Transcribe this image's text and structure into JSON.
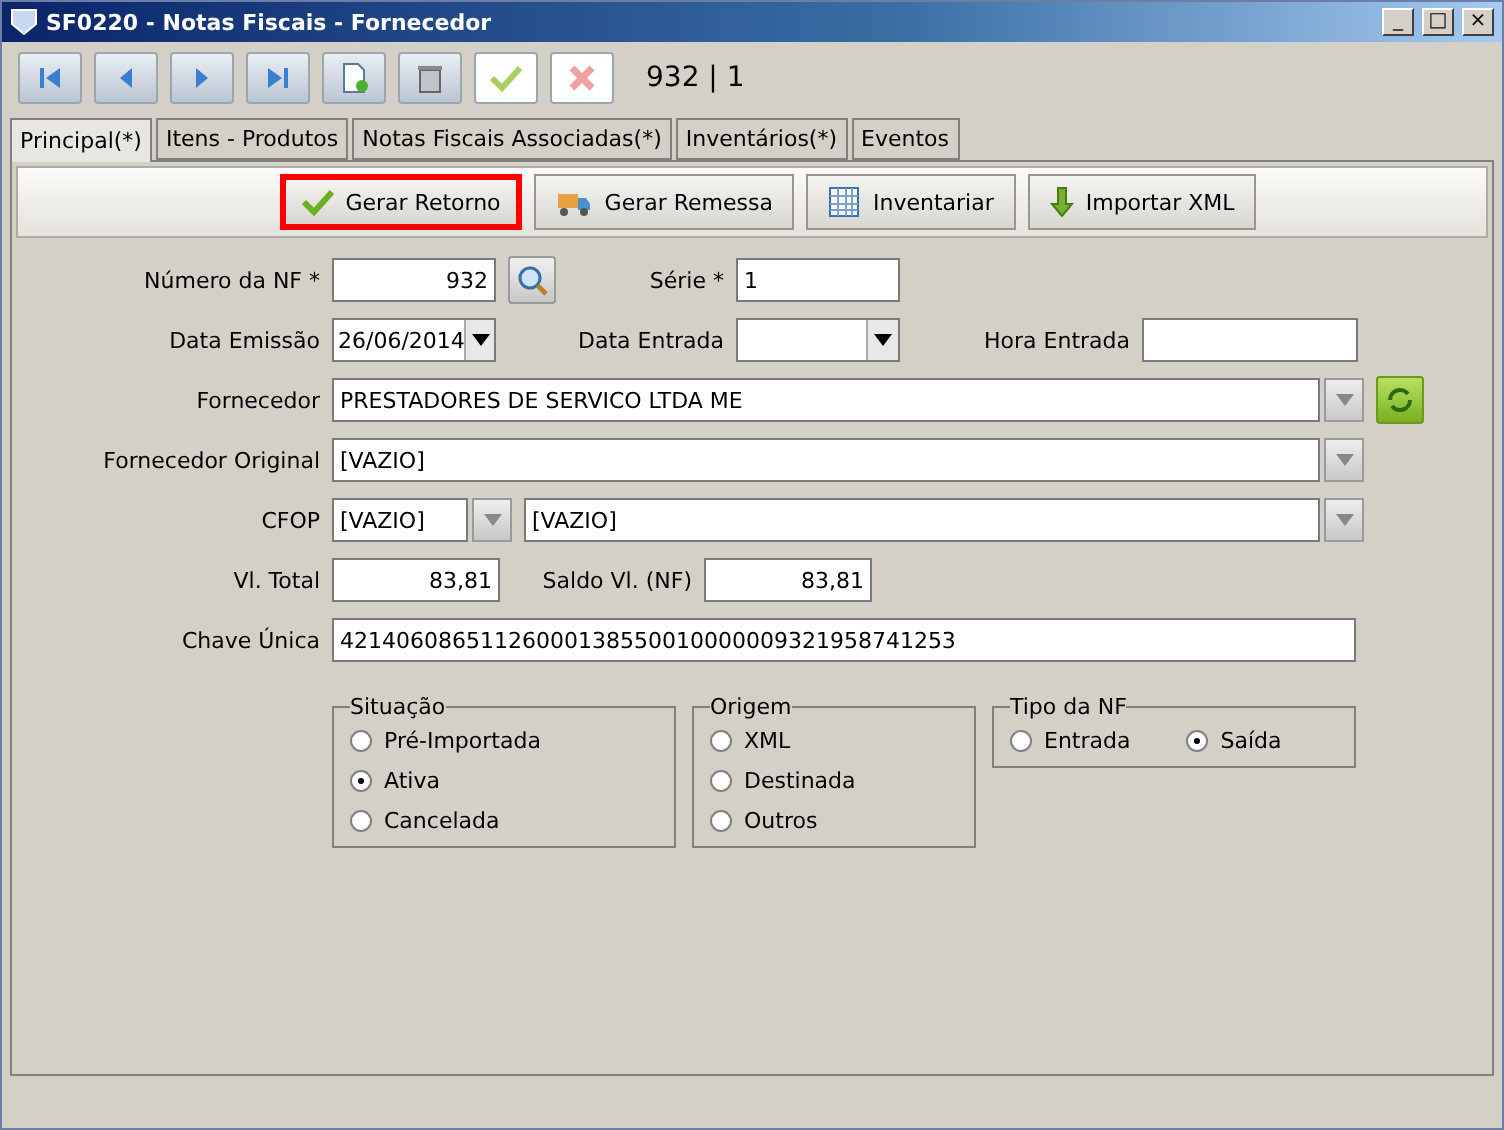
{
  "window": {
    "title": "SF0220 - Notas Fiscais - Fornecedor",
    "controls": [
      "_",
      "□",
      "×"
    ]
  },
  "toolbar": {
    "buttons": [
      {
        "kind": "first",
        "disabled": false
      },
      {
        "kind": "prev",
        "disabled": false
      },
      {
        "kind": "next",
        "disabled": false
      },
      {
        "kind": "last",
        "disabled": false
      },
      {
        "kind": "new",
        "disabled": false
      },
      {
        "kind": "delete",
        "disabled": false
      },
      {
        "kind": "save",
        "disabled": true
      },
      {
        "kind": "cancel",
        "disabled": true
      }
    ],
    "record": "932 | 1"
  },
  "tabs": [
    {
      "label": "Principal(*)",
      "selected": true
    },
    {
      "label": "Itens - Produtos",
      "selected": false
    },
    {
      "label": "Notas Fiscais Associadas(*)",
      "selected": false
    },
    {
      "label": "Inventários(*)",
      "selected": false
    },
    {
      "label": "Eventos",
      "selected": false
    }
  ],
  "actions": [
    {
      "label": "Gerar Retorno",
      "kind": "check",
      "focused": true
    },
    {
      "label": "Gerar Remessa",
      "kind": "truck",
      "focused": false
    },
    {
      "label": "Inventariar",
      "kind": "grid",
      "focused": false
    },
    {
      "label": "Importar XML",
      "kind": "down",
      "focused": false
    }
  ],
  "form": {
    "numero": {
      "label": "Número da NF *",
      "value": "932"
    },
    "serie": {
      "label": "Série *",
      "value": "1"
    },
    "emissao": {
      "label": "Data Emissão",
      "value": "26/06/2014"
    },
    "entrada": {
      "label": "Data Entrada"
    },
    "hora": {
      "label": "Hora Entrada"
    },
    "fornecedor": {
      "label": "Fornecedor",
      "value": "PRESTADORES DE SERVICO LTDA ME"
    },
    "original": {
      "label": "Fornecedor Original",
      "value": "[VAZIO]"
    },
    "cfop": {
      "label": "CFOP",
      "code": "[VAZIO]",
      "description": "[VAZIO]"
    },
    "total": {
      "label": "Vl. Total",
      "value": "83,81"
    },
    "saldo": {
      "label": "Saldo Vl. (NF)",
      "value": "83,81"
    },
    "chave": {
      "label": "Chave Única",
      "value": "42140608651126000138550010000009321958741253"
    }
  },
  "groups": [
    {
      "title": "Situação",
      "options": [
        {
          "label": "Pré-Importada",
          "selected": false
        },
        {
          "label": "Ativa",
          "selected": true
        },
        {
          "label": "Cancelada",
          "selected": false
        }
      ]
    },
    {
      "title": "Origem",
      "options": [
        {
          "label": "XML",
          "selected": false
        },
        {
          "label": "Destinada",
          "selected": false
        },
        {
          "label": "Outros",
          "selected": false
        }
      ]
    },
    {
      "title": "Tipo da NF",
      "options": [
        {
          "label": "Entrada",
          "selected": false
        },
        {
          "label": "Saída",
          "selected": true
        }
      ]
    }
  ]
}
